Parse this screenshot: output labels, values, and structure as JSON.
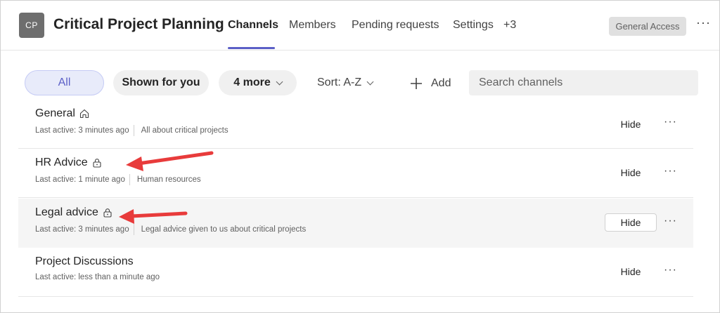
{
  "header": {
    "avatar_initials": "CP",
    "team_title": "Critical Project Planning",
    "tabs": [
      {
        "label": "Channels",
        "active": true
      },
      {
        "label": "Members",
        "active": false
      },
      {
        "label": "Pending requests",
        "active": false
      },
      {
        "label": "Settings",
        "active": false
      }
    ],
    "overflow_tabs": "+3",
    "access_badge": "General Access",
    "accent_color": "#5b5fc7"
  },
  "filters": {
    "all_label": "All",
    "shown_label": "Shown for you",
    "more_label": "4 more",
    "sort_label": "Sort: A-Z",
    "add_label": "Add",
    "search_placeholder": "Search channels"
  },
  "channels": [
    {
      "name": "General",
      "icon": "home-icon",
      "last_active": "Last active: 3 minutes ago",
      "description": "All about critical projects",
      "hide_label": "Hide"
    },
    {
      "name": "HR Advice",
      "icon": "lock-icon",
      "last_active": "Last active: 1 minute ago",
      "description": "Human resources",
      "hide_label": "Hide"
    },
    {
      "name": "Legal advice",
      "icon": "lock-icon",
      "last_active": "Last active: 3 minutes ago",
      "description": "Legal advice given to us about critical projects",
      "hide_label": "Hide"
    },
    {
      "name": "Project Discussions",
      "icon": "",
      "last_active": "Last active: less than a minute ago",
      "description": "",
      "hide_label": "Hide"
    }
  ],
  "annotation_color": "#e83b3b"
}
